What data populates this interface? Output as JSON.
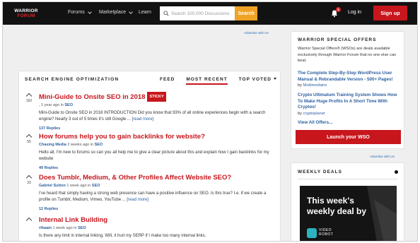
{
  "header": {
    "logo_line1": "WARRIOR",
    "logo_line2": "FORUM",
    "nav": [
      {
        "label": "Forums"
      },
      {
        "label": "Marketplace"
      },
      {
        "label": "Learn"
      }
    ],
    "search_placeholder": "Search 100,000 Discussions",
    "search_button": "Search",
    "notification_count": "1",
    "login": "Log in",
    "signup": "Sign up"
  },
  "ads": {
    "top": "Advertise with Us",
    "side": "Advertise with Us"
  },
  "main": {
    "heading": "SEARCH ENGINE OPTIMIZATION",
    "tabs": [
      {
        "label": "FEED"
      },
      {
        "label": "MOST RECENT"
      },
      {
        "label": "TOP VOTED"
      }
    ],
    "threads": [
      {
        "votes": "162",
        "title": "Mini-Guide to Onsite SEO in 2018",
        "sticky": "STICKY",
        "author": "",
        "meta": ", 1 year ago in",
        "category": "SEO",
        "excerpt": "Mini-Guide to Onsite SEO in 2018 INTRODUCTION Did you know that 93% of all online experiences begin with a search engine? Nearly 3 out of 5 times it's still Google ...",
        "more": "[read more]",
        "replies": "137 Replies"
      },
      {
        "votes": "55",
        "title": "How forums help you to gain backlinks for website?",
        "author": "Chasing Media",
        "meta": "2 weeks ago in",
        "category": "SEO",
        "excerpt": "Hello all, I'm new to forums so can you all help me to give a clear picture about this and explain how I gain backlinks for my website",
        "more": "",
        "replies": "49 Replies"
      },
      {
        "votes": "33",
        "title": "Does Tumblr, Medium, & Other Profiles Affect Website SEO?",
        "author": "Gabriel Sutton",
        "meta": "1 week ago in",
        "category": "SEO",
        "excerpt": "I've heard that simply having a strong web presence can have a positive influence on SEO. Is this true? I.e. if we create a profile on Tumblr, Medium, Vimeo, YouTube ...",
        "more": "[read more]",
        "replies": "12 Replies"
      },
      {
        "votes": "",
        "title": "Internal Link Building",
        "author": "rihaam",
        "meta": "1 week ago in",
        "category": "SEO",
        "excerpt": "Is there any limit in internal linking. Will, it hurt my SERP if I make too many internal links.",
        "more": "",
        "replies": ""
      }
    ]
  },
  "sidebar": {
    "wso_title": "WARRIOR SPECIAL OFFERS",
    "wso_intro": "Warrior Special Offers® (WSOs) are deals available exclusively through Warrior Forum that no one else can beat.",
    "wso_items": [
      {
        "title": "The Complete Step-By-Step WordPress User Manual & Rebrandable Version - 500+ Pages!",
        "by": "by",
        "author": "Multimediaire"
      },
      {
        "title": "Crypto Ultimatum Training System Shows How To Make Huge Profits In A Short Time With Cryptos!",
        "by": "by",
        "author": "cryptoplanet"
      }
    ],
    "view_all": "View All Offers...",
    "launch": "Launch your WSO",
    "deals_title": "WEEKLY DEALS",
    "deal_line1": "This week's",
    "deal_line2": "weekly deal by",
    "deal_brand1": "VIDEO",
    "deal_brand2": "ROBOT"
  },
  "colors": {
    "brand_red": "#c8161d",
    "search_orange": "#f0a224",
    "link_blue": "#2c5fa0",
    "topbar": "#121212"
  }
}
